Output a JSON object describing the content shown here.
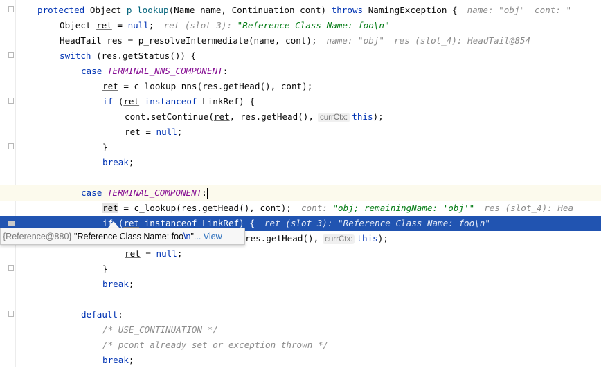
{
  "editor": {
    "line1": {
      "kw_protected": "protected",
      "type_object": " Object ",
      "method": "p_lookup",
      "params": "(Name name, Continuation cont) ",
      "kw_throws": "throws",
      "exc": " NamingException {",
      "hint1": "name: \"obj\"",
      "hint2": "cont: \""
    },
    "line2": {
      "prefix": "Object ",
      "var": "ret",
      "eq": " = ",
      "kw_null": "null",
      "semi": ";",
      "hint_label": "ret (slot_3): ",
      "hint_value": "\"Reference Class Name: foo\\n\""
    },
    "line3": {
      "code": "HeadTail res = p_resolveIntermediate(name, cont);",
      "hint1": "name: \"obj\"",
      "hint2": "res (slot_4): HeadTail@854"
    },
    "line4": {
      "kw_switch": "switch",
      "code": " (res.getStatus()) {"
    },
    "line5": {
      "kw_case": "case",
      "const": "TERMINAL_NNS_COMPONENT",
      "colon": ":"
    },
    "line6": {
      "var": "ret",
      "code": " = c_lookup_nns(res.getHead(), cont);"
    },
    "line7": {
      "kw_if": "if",
      "open": " (",
      "var": "ret",
      "kw_instanceof": " instanceof",
      "code": " LinkRef) {"
    },
    "line8": {
      "code_a": "cont.setContinue(",
      "var": "ret",
      "code_b": ", res.getHead(),",
      "pill": "currCtx:",
      "kw_this": "this",
      "code_c": ");"
    },
    "line9": {
      "var": "ret",
      "eq": " = ",
      "kw_null": "null",
      "semi": ";"
    },
    "line10": {
      "code": "}"
    },
    "line11": {
      "kw_break": "break",
      "semi": ";"
    },
    "line13": {
      "kw_case": "case",
      "const": "TERMINAL_COMPONENT",
      "colon": ":"
    },
    "line14": {
      "var": "ret",
      "code": " = c_lookup(res.getHead(), cont);",
      "hint1_label": "cont: ",
      "hint1_value": "\"obj; remainingName: 'obj'\"",
      "hint2": "res (slot_4): Hea"
    },
    "line15": {
      "kw_if": "if",
      "open": " (",
      "var": "ret",
      "kw_instanceof": " instanceof",
      "code": " LinkRef) {",
      "hint": "ret (slot_3): \"Reference Class Name: foo\\n\""
    },
    "line16": {
      "code": "res.getHead(),",
      "pill": "currCtx:",
      "kw_this": "this",
      "code_c": ");"
    },
    "line17": {
      "var": "ret",
      "eq": " = ",
      "kw_null": "null",
      "semi": ";"
    },
    "line18": {
      "code": "}"
    },
    "line19": {
      "kw_break": "break",
      "semi": ";"
    },
    "line21": {
      "kw_default": "default",
      "colon": ":"
    },
    "line22": {
      "comment": "/* USE_CONTINUATION */"
    },
    "line23": {
      "comment": "/* pcont already set or exception thrown */"
    },
    "line24": {
      "kw_break": "break",
      "semi": ";"
    }
  },
  "tooltip": {
    "ref": "{Reference@880}",
    "value_a": " \"Reference Class Name: foo",
    "value_esc": "\\n",
    "value_b": "\"",
    "link": "... View"
  },
  "colors": {
    "keyword": "#0033b3",
    "constant": "#871094",
    "method": "#00627a",
    "string": "#067d17",
    "hint": "#8c8c8c",
    "execution_line": "#2154b1",
    "caret_line": "#fcfaed"
  }
}
